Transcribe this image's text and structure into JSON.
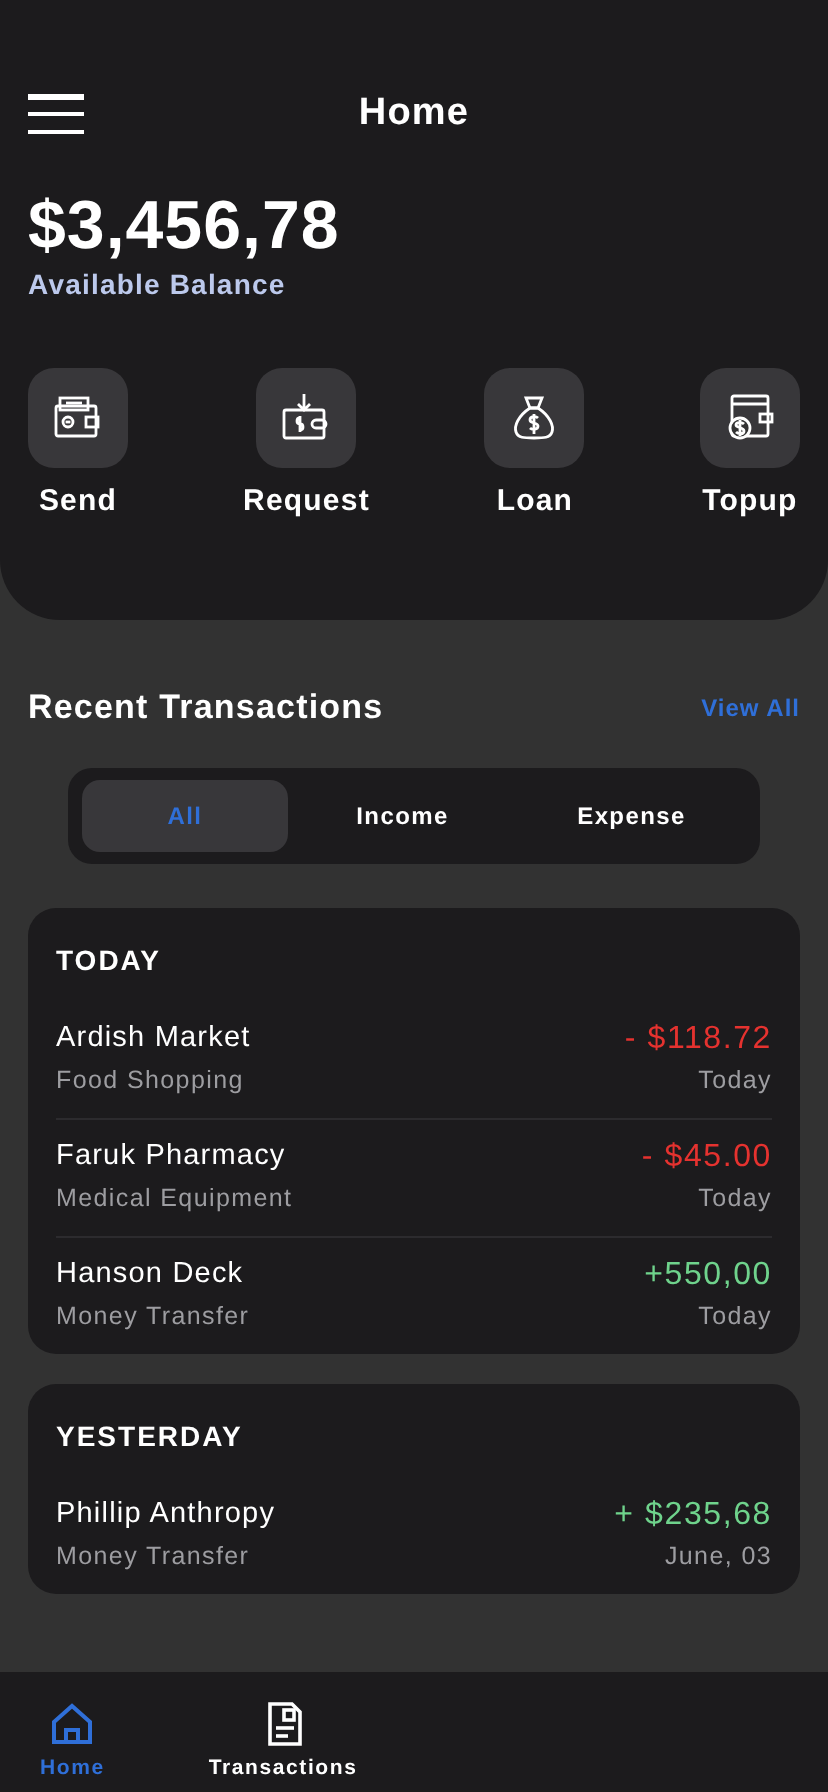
{
  "header": {
    "title": "Home"
  },
  "balance": {
    "amount": "$3,456,78",
    "label": "Available Balance"
  },
  "actions": [
    {
      "kind": "send",
      "label": "Send"
    },
    {
      "kind": "request",
      "label": "Request"
    },
    {
      "kind": "loan",
      "label": "Loan"
    },
    {
      "kind": "topup",
      "label": "Topup"
    }
  ],
  "recent": {
    "title": "Recent Transactions",
    "link": "View All"
  },
  "tabs": [
    {
      "label": "All",
      "selected": true
    },
    {
      "label": "Income",
      "selected": false
    },
    {
      "label": "Expense",
      "selected": false
    }
  ],
  "groups": [
    {
      "title": "TODAY",
      "transactions": [
        {
          "name": "Ardish Market",
          "category": "Food Shopping",
          "amount": "- $118.72",
          "date": "Today",
          "kind": "expense"
        },
        {
          "name": "Faruk Pharmacy",
          "category": "Medical Equipment",
          "amount": "- $45.00",
          "date": "Today",
          "kind": "expense"
        },
        {
          "name": "Hanson Deck",
          "category": "Money Transfer",
          "amount": "+550,00",
          "date": "Today",
          "kind": "income"
        }
      ]
    },
    {
      "title": "YESTERDAY",
      "transactions": [
        {
          "name": "Phillip Anthropy",
          "category": "Money Transfer",
          "amount": "+ $235,68",
          "date": "June, 03",
          "kind": "income"
        }
      ]
    }
  ],
  "nav": [
    {
      "kind": "home",
      "label": "Home",
      "selected": true
    },
    {
      "kind": "transactions",
      "label": "Transactions",
      "selected": false
    }
  ]
}
